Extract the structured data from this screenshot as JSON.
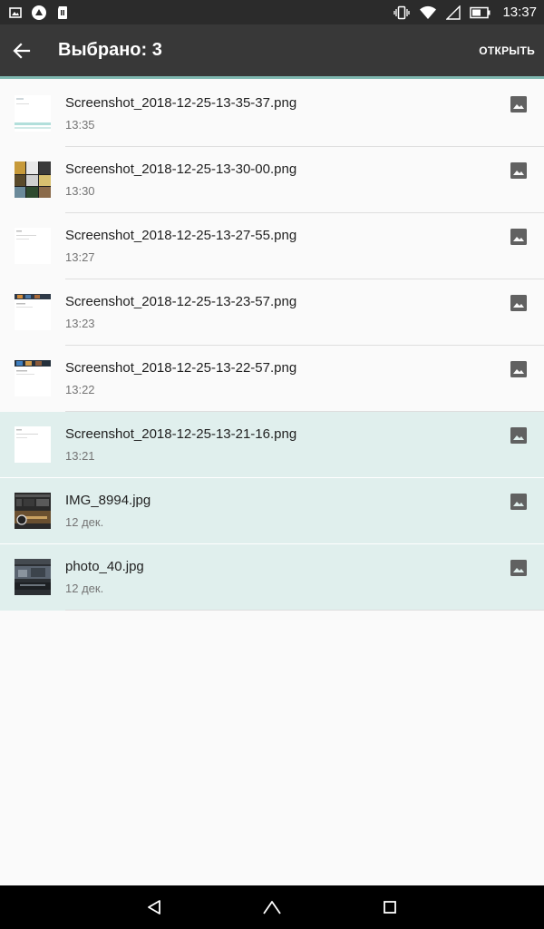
{
  "status_bar": {
    "time": "13:37"
  },
  "action_bar": {
    "title": "Выбрано: 3",
    "open_label": "ОТКРЫТЬ"
  },
  "files": [
    {
      "name": "Screenshot_2018-12-25-13-35-37.png",
      "date": "13:35",
      "selected": false
    },
    {
      "name": "Screenshot_2018-12-25-13-30-00.png",
      "date": "13:30",
      "selected": false
    },
    {
      "name": "Screenshot_2018-12-25-13-27-55.png",
      "date": "13:27",
      "selected": false
    },
    {
      "name": "Screenshot_2018-12-25-13-23-57.png",
      "date": "13:23",
      "selected": false
    },
    {
      "name": "Screenshot_2018-12-25-13-22-57.png",
      "date": "13:22",
      "selected": false
    },
    {
      "name": "Screenshot_2018-12-25-13-21-16.png",
      "date": "13:21",
      "selected": true
    },
    {
      "name": "IMG_8994.jpg",
      "date": "12 дек.",
      "selected": true
    },
    {
      "name": "photo_40.jpg",
      "date": "12 дек.",
      "selected": true
    }
  ],
  "colors": {
    "status_bar": "#2b2b2b",
    "action_bar": "#383838",
    "accent_line": "#7fb8b0",
    "selected_row": "#e0efed",
    "icon_gray": "#616161"
  },
  "icons": {
    "back": "arrow-left-icon",
    "file_type": "image-icon",
    "nav_back": "triangle-back-icon",
    "nav_home": "home-icon",
    "nav_recents": "square-recents-icon"
  }
}
